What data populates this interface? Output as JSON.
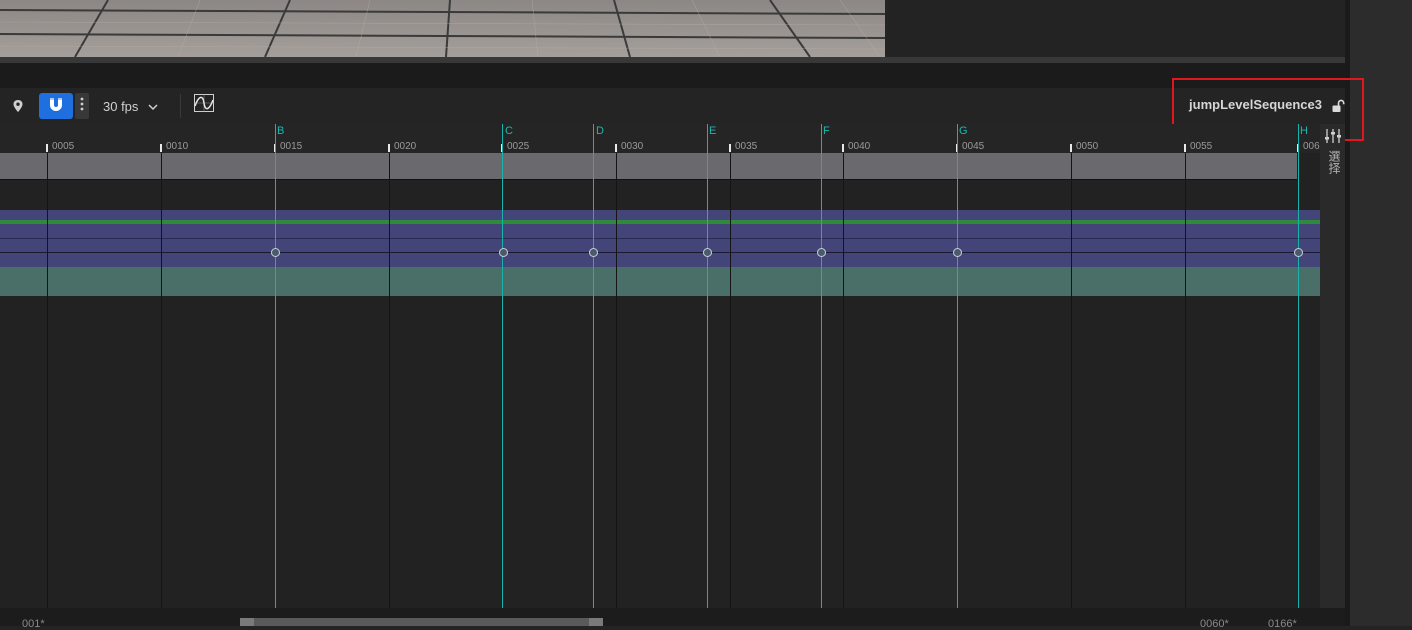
{
  "viewport": {
    "label": "viewport-preview"
  },
  "toolbar": {
    "snap_icon": "magnet-icon",
    "pin_icon": "location-pin-icon",
    "more_icon": "vertical-dots-icon",
    "fps": "30 fps",
    "fps_icon": "chevron-down-icon",
    "curve_icon": "curve-editor-icon",
    "sequence_name": "jumpLevelSequence3",
    "lock_icon": "unlock-icon",
    "accent_color": "#1f6fe0"
  },
  "ruler": {
    "ticks": [
      "0005",
      "0010",
      "0015",
      "0020",
      "0025",
      "0030",
      "0035",
      "0040",
      "0045",
      "0050",
      "0055",
      "006"
    ],
    "markers": [
      "B",
      "C",
      "D",
      "E",
      "F",
      "G",
      "H"
    ],
    "marker_color": "#19b3ac"
  },
  "side_panel": {
    "filter_icon": "filter-sliders-icon",
    "vertical_text": "選择"
  },
  "bottom": {
    "range_start": "001*",
    "range_end": "0060*",
    "range_total": "0166*"
  },
  "highlight": {
    "color": "#e0181e",
    "target": "sequence_name"
  }
}
